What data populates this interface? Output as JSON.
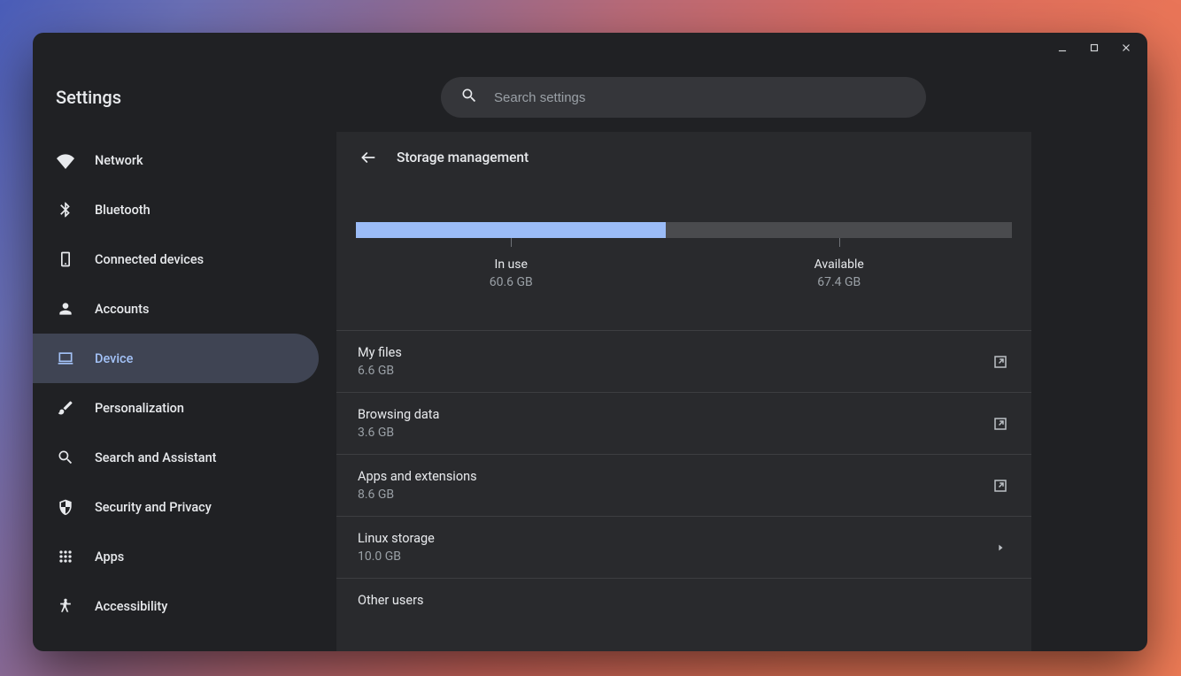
{
  "app_title": "Settings",
  "search": {
    "placeholder": "Search settings"
  },
  "sidebar": {
    "items": [
      {
        "label": "Network"
      },
      {
        "label": "Bluetooth"
      },
      {
        "label": "Connected devices"
      },
      {
        "label": "Accounts"
      },
      {
        "label": "Device"
      },
      {
        "label": "Personalization"
      },
      {
        "label": "Search and Assistant"
      },
      {
        "label": "Security and Privacy"
      },
      {
        "label": "Apps"
      },
      {
        "label": "Accessibility"
      }
    ],
    "active_index": 4
  },
  "page": {
    "title": "Storage management",
    "storage": {
      "in_use": {
        "label": "In use",
        "value": "60.6 GB"
      },
      "available": {
        "label": "Available",
        "value": "67.4 GB"
      },
      "used_percent": 47.3
    },
    "rows": [
      {
        "title": "My files",
        "value": "6.6 GB",
        "action": "open"
      },
      {
        "title": "Browsing data",
        "value": "3.6 GB",
        "action": "open"
      },
      {
        "title": "Apps and extensions",
        "value": "8.6 GB",
        "action": "open"
      },
      {
        "title": "Linux storage",
        "value": "10.0 GB",
        "action": "drill"
      },
      {
        "title": "Other users",
        "value": "",
        "action": "drill"
      }
    ]
  }
}
